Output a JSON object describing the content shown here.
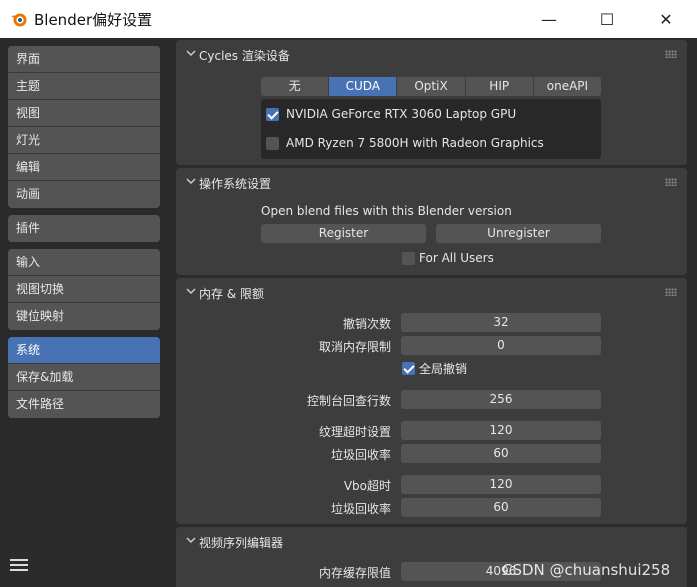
{
  "window": {
    "title": "Blender偏好设置",
    "minimize_glyph": "—",
    "maximize_glyph": "☐",
    "close_glyph": "✕"
  },
  "sidebar": {
    "groups": [
      [
        "界面",
        "主题",
        "视图",
        "灯光",
        "编辑",
        "动画"
      ],
      [
        "插件"
      ],
      [
        "输入",
        "视图切换",
        "键位映射"
      ],
      [
        "系统",
        "保存&加载",
        "文件路径"
      ]
    ],
    "active": "系统"
  },
  "cycles": {
    "title": "Cycles 渲染设备",
    "tabs": [
      "无",
      "CUDA",
      "OptiX",
      "HIP",
      "oneAPI"
    ],
    "active_tab": "CUDA",
    "devices": [
      {
        "name": "NVIDIA GeForce RTX 3060 Laptop GPU",
        "checked": true
      },
      {
        "name": "AMD Ryzen 7 5800H with Radeon Graphics",
        "checked": false
      }
    ]
  },
  "os_settings": {
    "title": "操作系统设置",
    "open_label": "Open blend files with this Blender version",
    "register_label": "Register",
    "unregister_label": "Unregister",
    "all_users_label": "For All Users",
    "all_users_checked": false
  },
  "memory": {
    "title": "内存 & 限额",
    "undo_steps_label": "撤销次数",
    "undo_steps_value": "32",
    "undo_memory_label": "取消内存限制",
    "undo_memory_value": "0",
    "global_undo_label": "全局撤销",
    "global_undo_checked": true,
    "console_label": "控制台回查行数",
    "console_value": "256",
    "texture_timeout_label": "纹理超时设置",
    "texture_timeout_value": "120",
    "texture_gc_label": "垃圾回收率",
    "texture_gc_value": "60",
    "vbo_timeout_label": "Vbo超时",
    "vbo_timeout_value": "120",
    "vbo_gc_label": "垃圾回收率",
    "vbo_gc_value": "60"
  },
  "sequencer": {
    "title": "视频序列编辑器",
    "cache_label": "内存缓存限值",
    "cache_value": "4096"
  },
  "watermark": "CSDN @chuanshui258",
  "colors": {
    "accent": "#4772b3",
    "panel": "#3d3d3d",
    "widget": "#545454",
    "background": "#2b2b2b"
  }
}
